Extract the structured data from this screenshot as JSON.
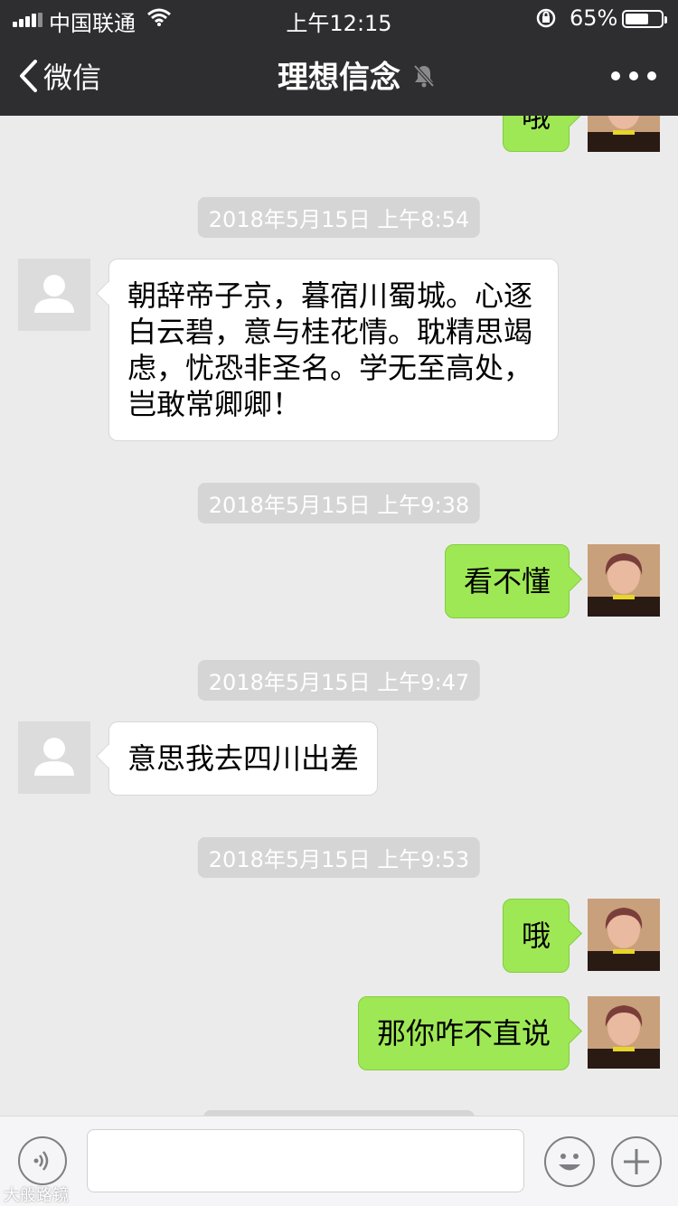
{
  "status_bar": {
    "carrier": "中国联通",
    "time": "上午12:15",
    "battery_percent": "65%",
    "battery_level": 0.65,
    "icons": [
      "signal-icon",
      "wifi-icon",
      "rotation-lock-icon",
      "battery-icon"
    ]
  },
  "nav": {
    "back_label": "微信",
    "title": "理想信念",
    "title_icon": "mute-bell-icon",
    "more_icon": "more-dots-icon"
  },
  "chat": {
    "partial_top_message": {
      "side": "right",
      "text": "哦"
    },
    "items": [
      {
        "type": "timestamp",
        "text": "2018年5月15日 上午8:54"
      },
      {
        "type": "message",
        "side": "left",
        "text": "朝辞帝子京，暮宿川蜀城。心逐白云碧，意与桂花情。耽精思竭虑，忧恐非圣名。学无至高处，岂敢常卿卿！"
      },
      {
        "type": "timestamp",
        "text": "2018年5月15日 上午9:38"
      },
      {
        "type": "message",
        "side": "right",
        "text": "看不懂"
      },
      {
        "type": "timestamp",
        "text": "2018年5月15日 上午9:47"
      },
      {
        "type": "message",
        "side": "left",
        "text": "意思我去四川出差"
      },
      {
        "type": "timestamp",
        "text": "2018年5月15日 上午9:53"
      },
      {
        "type": "message",
        "side": "right",
        "text": "哦"
      },
      {
        "type": "message",
        "side": "right",
        "text": "那你咋不直说"
      }
    ]
  },
  "input_bar": {
    "voice_icon": "voice-icon",
    "emoji_icon": "emoji-icon",
    "plus_icon": "plus-icon",
    "input_value": ""
  },
  "watermark": "大般路镜",
  "colors": {
    "header_bg": "#2e2e30",
    "chat_bg": "#ebebeb",
    "sent_bubble": "#9ee855",
    "received_bubble": "#ffffff",
    "timestamp_bg": "#d5d5d5"
  }
}
